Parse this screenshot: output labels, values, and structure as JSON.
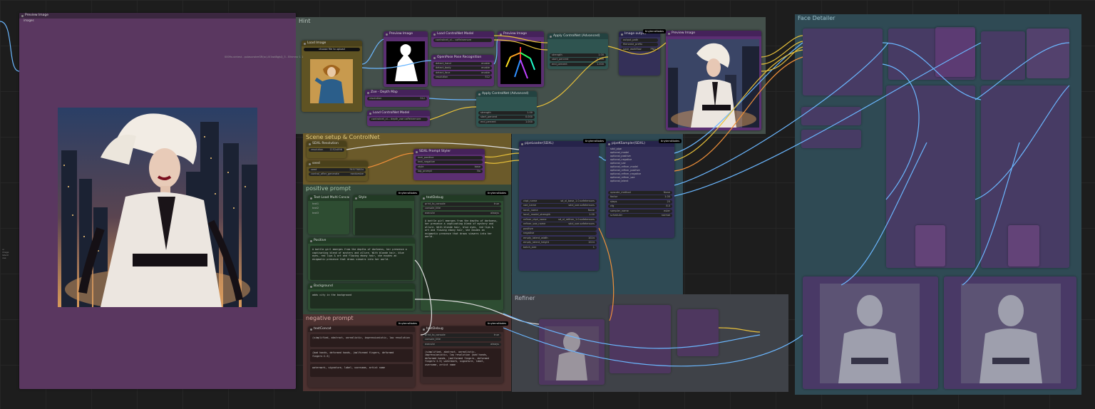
{
  "canvas": {
    "background": "#1d1d1d"
  },
  "colors": {
    "preview_node": "#5a3760",
    "group_top": "#44504b",
    "group_setup": "#6b5a2a",
    "group_positive": "#34483a",
    "group_negative": "#4d3231",
    "group_detailer": "#2f4a54",
    "group_refiner": "#3f4248",
    "node_purple": "#5b2f72",
    "node_green": "#2e4d32",
    "node_teal": "#2f5450",
    "node_brown": "#3d2a2a",
    "node_blue": "#343058",
    "node_yellow": "#5f5323",
    "wire_blue": "#6bb7ff",
    "wire_yellow": "#e8c13a",
    "wire_orange": "#f0903a",
    "wire_white": "#dddddd"
  },
  "left_preview": {
    "title": "Preview Image",
    "input": "images"
  },
  "groups": {
    "top": "Hint",
    "setup": "Scene setup & ControlNet",
    "positive": "positive prompt",
    "negative": "negative prompt",
    "refiner": "Refiner",
    "detailer": "Face Detailer"
  },
  "nodes": {
    "load_image": {
      "title": "Load Image",
      "file": "choose file to upload",
      "path": "0009x-vintest - pulasunsterGR(sc)-Vi1wd8gJsQ_sv6AM-2nal-bar-9dnsai",
      "meta": "0009x-vintest - pulasunsterGR(sc)-Vi1wd8gJsQ_3 - Elhimrsr 1 1 aulumnns wlnmidi 1 1 ank"
    },
    "preview_image_pose": {
      "title": "Preview Image",
      "input": "images"
    },
    "load_controlnet_1": {
      "title": "Load ControlNet Model",
      "value": "controlnet_xl... caffeinemore"
    },
    "openpose": {
      "title": "OpenPose Pose Recognition",
      "fields": [
        "detect_hand",
        "detect_body",
        "detect_face",
        "resolution"
      ],
      "values": [
        "enable",
        "enable",
        "enable",
        "512"
      ]
    },
    "preview_image_2": {
      "title": "Preview Image",
      "input": "images"
    },
    "apply_controlnet_1": {
      "title": "Apply ControlNet (Advanced)",
      "fields": [
        "strength",
        "start_percent",
        "end_percent"
      ],
      "values": [
        "1.00",
        "0.000",
        "1.000"
      ]
    },
    "zoe_depth": {
      "title": "Zoe - Depth Map",
      "field": "resolution",
      "value": "512"
    },
    "load_controlnet_2": {
      "title": "Load ControlNet Model",
      "value": "controlnet_xl... depth_zoe caffeinemore"
    },
    "apply_controlnet_2": {
      "title": "Apply ControlNet (Advanced)",
      "fields": [
        "strength",
        "start_percent",
        "end_percent"
      ],
      "values": [
        "1.00",
        "0.000",
        "1.000"
      ]
    },
    "sdxl_resolution": {
      "title": "SDXL Resolution",
      "field": "resolution",
      "value": "1152x896"
    },
    "seed": {
      "title": "seed",
      "fields": [
        "seed",
        "control_after_generate"
      ],
      "values": [
        "793778834",
        "randomize"
      ]
    },
    "prompt_styler": {
      "title": "SDXL Prompt Styler",
      "fields": [
        "text_positive",
        "text_negative",
        "style",
        "log_prompt"
      ],
      "values": [
        "",
        "",
        "base",
        "No"
      ]
    },
    "multi_concat": {
      "title": "Text Load Multi Concat",
      "fields": [
        "text1",
        "text2",
        "text3"
      ]
    },
    "style_node": {
      "title": "Style"
    },
    "positive_text": {
      "title": "Positive",
      "text": "A bottle girl emerges from the depths of darkness, her presence a captivating blend of mystery and allure. With blonde hair, blue eyes, red lips & art and flowing ebony hair, she exudes an enigmatic presence that draws viewers into her world."
    },
    "background": {
      "title": "Background",
      "text": "adds city in the background"
    },
    "text_debug_pos": {
      "title": "textDebug",
      "fields": [
        "print_to_console",
        "console_title",
        "execute"
      ],
      "values": [
        "true",
        "",
        "always"
      ],
      "text": "A bottle girl emerges from the depths of darkness, her presence a captivating blend of mystery and allure. With blonde hair, blue eyes, red lips & art and flowing ebony hair, she exudes an enigmatic presence that draws viewers into her world."
    },
    "negative_concat": {
      "title": "textConcat",
      "texts": [
        "(simplified, abstract, unrealistic, impressionistic, low resolution",
        "(bad hands, deformed hands, (malformed fingers, deformed fingers:1.5)",
        "watermark, signature, label, username, artist name"
      ]
    },
    "text_debug_neg": {
      "title": "textDebug",
      "fields": [
        "print_to_console",
        "console_title",
        "execute"
      ],
      "values": [
        "true",
        "",
        "always"
      ],
      "text": "(simplified, abstract, unrealistic, impressionistic, low resolution (bad hands, deformed hands, (malformed fingers, deformed fingers:1.5) watermark, signature, label, username, artist name"
    },
    "pipe_loader": {
      "title": "pipeLoader(SDXL)",
      "fields": [
        "ckpt_name",
        "vae_name",
        "lora1_name",
        "lora1_model_strength",
        "refiner_ckpt_name",
        "refiner_vae_name",
        "positive",
        "negative",
        "empty_latent_width",
        "empty_latent_height",
        "batch_size"
      ],
      "values": [
        "sd_xl_base_1.0.safetensors",
        "sdxl_vae.safetensors",
        "None",
        "1.00",
        "sd_xl_refiner_1.0.safetensors",
        "sdxl_vae.safetensors",
        "None",
        "None",
        "1024",
        "1024",
        "1"
      ]
    },
    "pipe_ksampler": {
      "title": "pipeKSampler(SDXL)",
      "inputs": [
        "sdxl_pipe",
        "optional_model",
        "optional_positive",
        "optional_negative",
        "optional_vae",
        "optional_refiner_model",
        "optional_refiner_positive",
        "optional_refiner_negative",
        "optional_refiner_vae",
        "optional_latent"
      ],
      "fields": [
        "upscale_method",
        "factor",
        "steps",
        "cfg",
        "sampler_name",
        "scheduler"
      ],
      "values": [
        "None",
        "1.00",
        "25",
        "8.0",
        "euler",
        "normal"
      ]
    },
    "image_output": {
      "title": "Image output",
      "fields": [
        "output_path",
        "filename_prefix",
        "save_workflow"
      ],
      "values": [
        "ComfyUI",
        "ComfyUI",
        "PNG"
      ]
    },
    "preview_final": {
      "title": "Preview Image",
      "input": "images"
    }
  },
  "right_labels": [
    "ui",
    "image",
    "latent",
    "vae"
  ]
}
